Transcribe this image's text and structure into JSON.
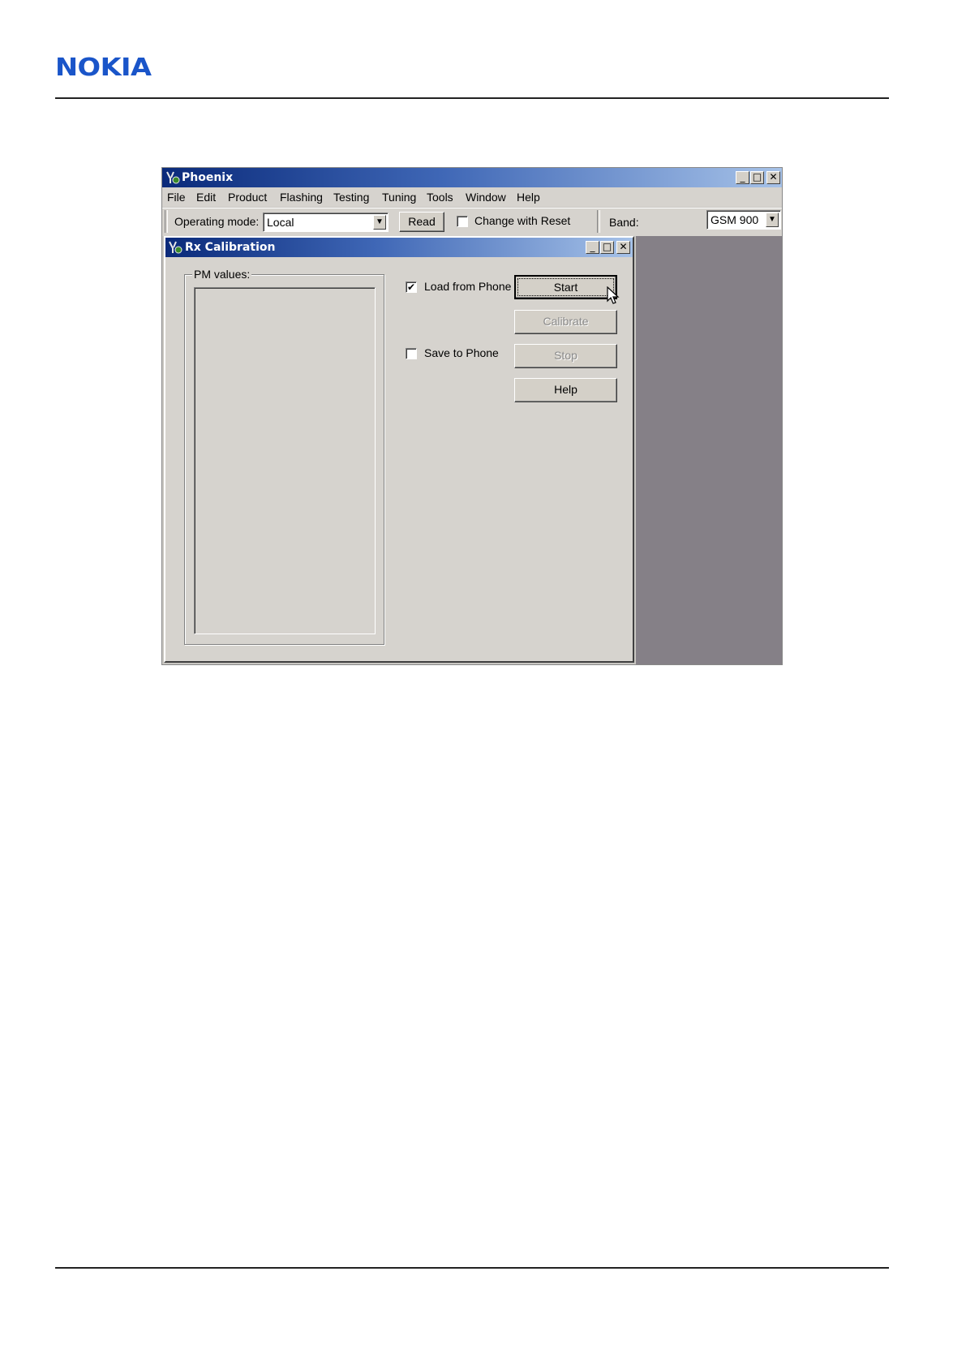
{
  "brand": {
    "logo_text": "NOKIA",
    "color": "#1a55c9"
  },
  "app": {
    "title": "Phoenix",
    "menu": [
      "File",
      "Edit",
      "Product",
      "Flashing",
      "Testing",
      "Tuning",
      "Tools",
      "Window",
      "Help"
    ],
    "toolbar": {
      "operating_mode_label": "Operating mode:",
      "operating_mode_value": "Local",
      "read_label": "Read",
      "change_with_reset_label": "Change with Reset",
      "change_with_reset_checked": false,
      "band_label": "Band:",
      "band_value": "GSM 900"
    }
  },
  "rx_window": {
    "title": "Rx Calibration",
    "pm_values_label": "PM values:",
    "load_from_phone": {
      "label": "Load from Phone",
      "checked": true
    },
    "save_to_phone": {
      "label": "Save to Phone",
      "checked": false
    },
    "buttons": {
      "start": "Start",
      "calibrate": "Calibrate",
      "stop": "Stop",
      "help": "Help"
    }
  }
}
